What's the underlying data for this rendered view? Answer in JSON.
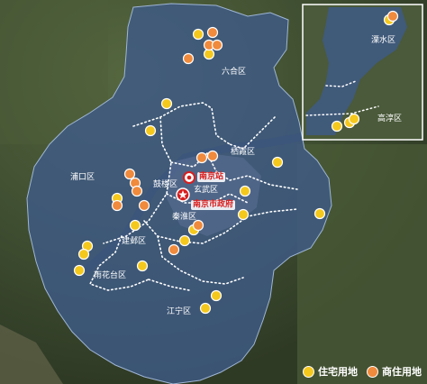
{
  "districts": {
    "luhe": "六合区",
    "pukou": "浦口区",
    "qixia": "栖霞区",
    "gulou": "鼓楼区",
    "xuanwu": "玄武区",
    "jianye": "建邺区",
    "qinhuai": "秦淮区",
    "yuhuatai": "雨花台区",
    "jiangning": "江宁区",
    "lishui": "溧水区",
    "gaochun": "高淳区"
  },
  "landmarks": {
    "station": "南京站",
    "government": "南京市政府"
  },
  "legend": {
    "residential": "住宅用地",
    "commercial_residential": "商住用地"
  },
  "colors": {
    "residential": "#f5c81d",
    "commercial_residential": "#f08a3c",
    "landmark_red": "#d81e1e",
    "city_overlay": "#3e5a86"
  },
  "icons": {
    "station": "station-icon",
    "government": "star-icon"
  }
}
